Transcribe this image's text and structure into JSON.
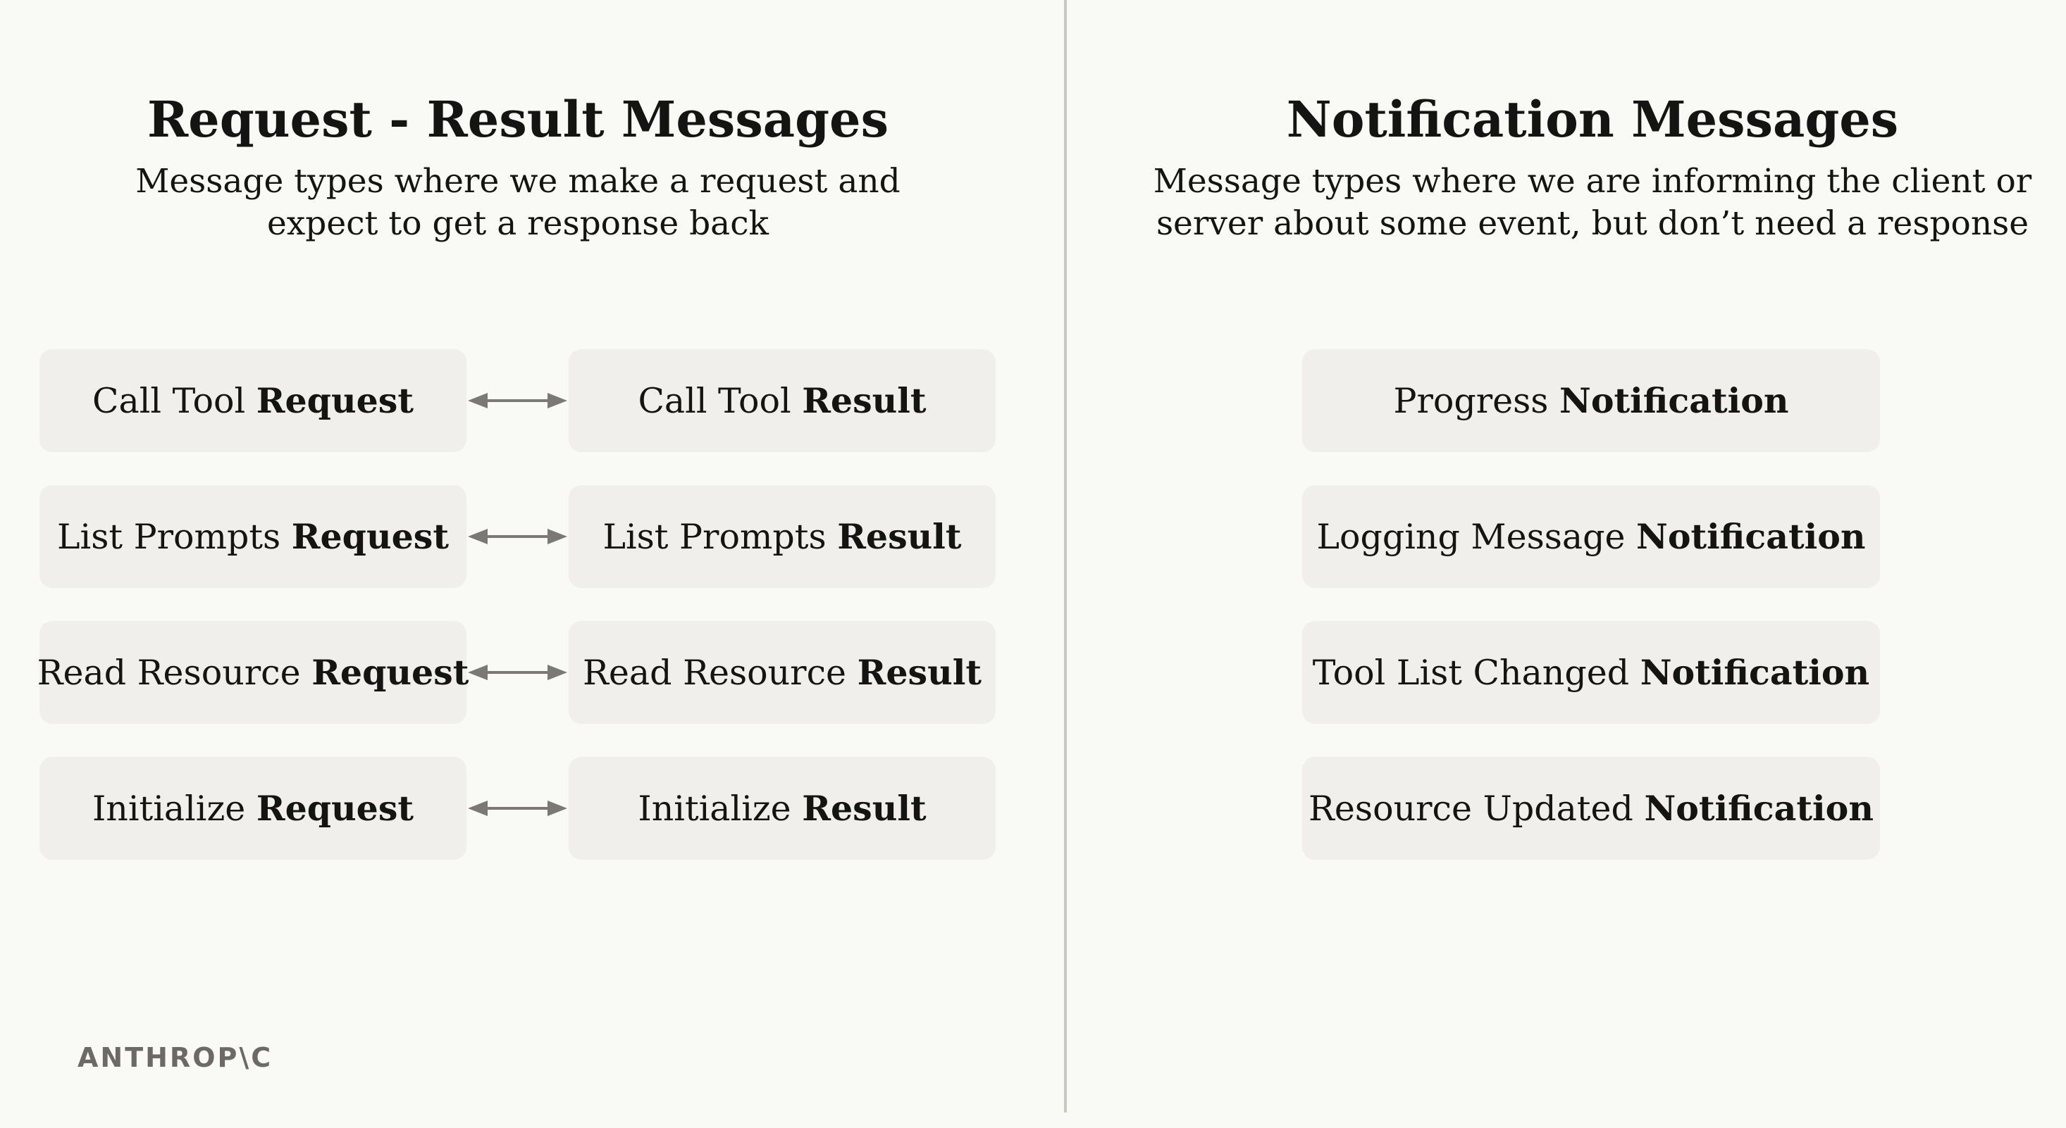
{
  "left_section": {
    "title": "Request - Result Messages",
    "subtitle_line1": "Message types where we make a request and",
    "subtitle_line2": "expect to get a response back"
  },
  "right_section": {
    "title": "Notification Messages",
    "subtitle_line1": "Message types where we are informing the client or",
    "subtitle_line2": "server about some event, but don’t need a response"
  },
  "pairs": [
    {
      "request": {
        "name": "Call Tool",
        "kind": "Request"
      },
      "result": {
        "name": "Call Tool",
        "kind": "Result"
      }
    },
    {
      "request": {
        "name": "List Prompts",
        "kind": "Request"
      },
      "result": {
        "name": "List Prompts",
        "kind": "Result"
      }
    },
    {
      "request": {
        "name": "Read Resource",
        "kind": "Request"
      },
      "result": {
        "name": "Read Resource",
        "kind": "Result"
      }
    },
    {
      "request": {
        "name": "Initialize",
        "kind": "Request"
      },
      "result": {
        "name": "Initialize",
        "kind": "Result"
      }
    }
  ],
  "notifications": [
    {
      "name": "Progress",
      "kind": "Notification"
    },
    {
      "name": "Logging Message",
      "kind": "Notification"
    },
    {
      "name": "Tool List Changed",
      "kind": "Notification"
    },
    {
      "name": "Resource Updated",
      "kind": "Notification"
    }
  ],
  "logo_text": "ANTHROP\\C",
  "colors": {
    "background": "#f9f9f6",
    "box": "#f0efeb",
    "text": "#141413",
    "arrow": "#7a7975",
    "divider": "#c9c8c2"
  }
}
